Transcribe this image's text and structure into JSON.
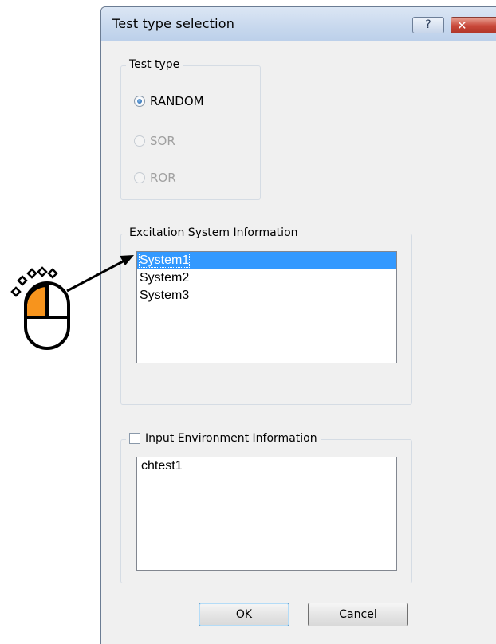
{
  "window": {
    "title": "Test type selection",
    "help_label": "?",
    "close_label": "✕"
  },
  "test_type": {
    "legend": "Test type",
    "options": [
      {
        "label": "RANDOM",
        "checked": true,
        "enabled": true
      },
      {
        "label": "SOR",
        "checked": false,
        "enabled": false
      },
      {
        "label": "ROR",
        "checked": false,
        "enabled": false
      }
    ]
  },
  "excitation": {
    "legend": "Excitation System Information",
    "items": [
      "System1",
      "System2",
      "System3"
    ],
    "selected_index": 0
  },
  "input_env": {
    "legend": "Input Environment Information",
    "checked": false,
    "items": [
      "chtest1"
    ]
  },
  "buttons": {
    "ok": "OK",
    "cancel": "Cancel"
  },
  "annotation": {
    "mouse_icon": "mouse-left-click-icon",
    "accent": "#f7941d"
  }
}
